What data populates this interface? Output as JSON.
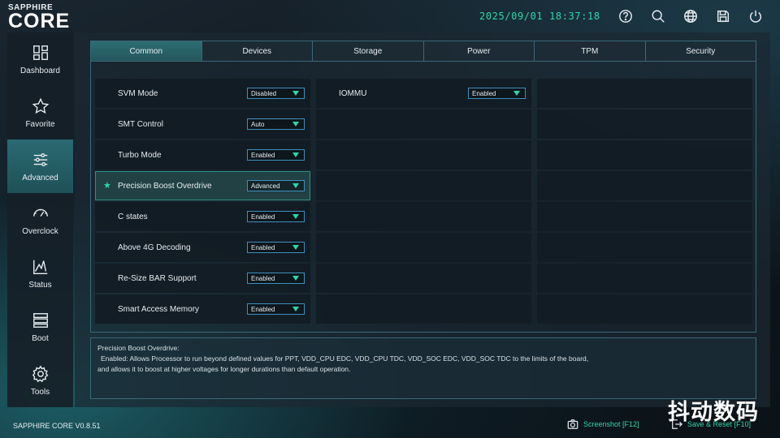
{
  "header": {
    "logo_top": "SAPPHIRE",
    "logo_main": "CORE",
    "datetime": "2025/09/01 18:37:18",
    "icons": [
      "help-icon",
      "search-icon",
      "globe-icon",
      "save-icon",
      "power-icon"
    ]
  },
  "sidebar": {
    "items": [
      {
        "label": "Dashboard",
        "icon": "dashboard-icon"
      },
      {
        "label": "Favorite",
        "icon": "star-icon"
      },
      {
        "label": "Advanced",
        "icon": "sliders-icon",
        "active": true
      },
      {
        "label": "Overclock",
        "icon": "gauge-icon"
      },
      {
        "label": "Status",
        "icon": "chart-icon"
      },
      {
        "label": "Boot",
        "icon": "boot-icon"
      },
      {
        "label": "Tools",
        "icon": "gear-icon"
      }
    ]
  },
  "tabs": [
    "Common",
    "Devices",
    "Storage",
    "Power",
    "TPM",
    "Security"
  ],
  "active_tab": "Common",
  "settings_left": [
    {
      "label": "SVM Mode",
      "value": "Disabled"
    },
    {
      "label": "SMT Control",
      "value": "Auto"
    },
    {
      "label": "Turbo Mode",
      "value": "Enabled"
    },
    {
      "label": "Precision Boost Overdrive",
      "value": "Advanced",
      "favorite": true,
      "selected": true
    },
    {
      "label": "C states",
      "value": "Enabled"
    },
    {
      "label": "Above 4G Decoding",
      "value": "Enabled"
    },
    {
      "label": "Re-Size BAR Support",
      "value": "Enabled"
    },
    {
      "label": "Smart Access Memory",
      "value": "Enabled"
    }
  ],
  "settings_mid": [
    {
      "label": "IOMMU",
      "value": "Enabled"
    }
  ],
  "help": {
    "title": "Precision Boost Overdrive:",
    "line1": "Enabled: Allows Processor to run beyond defined values for PPT, VDD_CPU EDC, VDD_CPU TDC, VDD_SOC EDC, VDD_SOC TDC to the limits of the board,",
    "line2": "and allows it to boost at higher voltages for longer durations than default operation."
  },
  "footer": {
    "version": "SAPPHIRE CORE V0.8.51",
    "screenshot": "Screenshot [F12]",
    "save_reset": "Save & Reset [F10]"
  },
  "watermark": "抖动数码",
  "colors": {
    "accent": "#2fd6a8",
    "active_tab": "#2d6e73",
    "border": "#3a6878",
    "dropdown_border": "#3f8fbd"
  }
}
